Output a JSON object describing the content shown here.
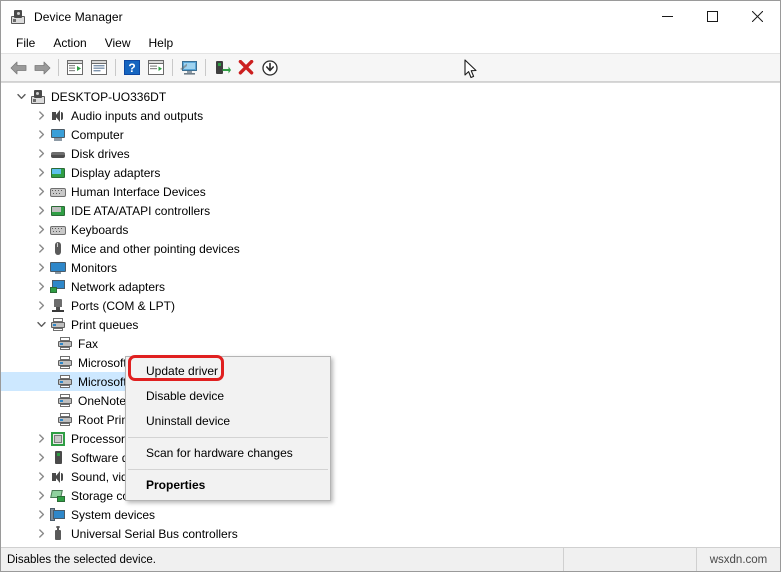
{
  "window": {
    "title": "Device Manager",
    "icon": "device-manager-icon",
    "controls": {
      "minimize": "minimize-icon",
      "maximize": "maximize-icon",
      "close": "close-icon"
    }
  },
  "menubar": {
    "items": [
      {
        "label": "File"
      },
      {
        "label": "Action"
      },
      {
        "label": "View"
      },
      {
        "label": "Help"
      }
    ]
  },
  "toolbar": {
    "buttons": [
      {
        "name": "back-icon",
        "tip": "Back"
      },
      {
        "name": "forward-icon",
        "tip": "Forward"
      },
      {
        "name": "show-hide-console-tree-icon",
        "tip": "Show/Hide Console Tree"
      },
      {
        "name": "properties-icon",
        "tip": "Properties"
      },
      {
        "name": "help-icon",
        "tip": "Help"
      },
      {
        "name": "show-hide-action-pane-icon",
        "tip": "Show/Hide Action Pane"
      },
      {
        "name": "scan-for-hardware-changes-icon",
        "tip": "Scan for hardware changes"
      },
      {
        "name": "update-driver-icon",
        "tip": "Update driver"
      },
      {
        "name": "uninstall-device-icon",
        "tip": "Uninstall device"
      },
      {
        "name": "disable-device-icon",
        "tip": "Disable device"
      }
    ]
  },
  "tree": {
    "root": {
      "label": "DESKTOP-UO336DT",
      "icon": "computer-root-icon",
      "expanded": true
    },
    "nodes": [
      {
        "label": "Audio inputs and outputs",
        "icon": "speaker-icon",
        "expanded": false,
        "level": 1
      },
      {
        "label": "Computer",
        "icon": "computer-icon",
        "expanded": false,
        "level": 1
      },
      {
        "label": "Disk drives",
        "icon": "disk-drive-icon",
        "expanded": false,
        "level": 1
      },
      {
        "label": "Display adapters",
        "icon": "display-adapter-icon",
        "expanded": false,
        "level": 1
      },
      {
        "label": "Human Interface Devices",
        "icon": "hid-icon",
        "expanded": false,
        "level": 1
      },
      {
        "label": "IDE ATA/ATAPI controllers",
        "icon": "ide-controller-icon",
        "expanded": false,
        "level": 1
      },
      {
        "label": "Keyboards",
        "icon": "keyboard-icon",
        "expanded": false,
        "level": 1
      },
      {
        "label": "Mice and other pointing devices",
        "icon": "mouse-icon",
        "expanded": false,
        "level": 1
      },
      {
        "label": "Monitors",
        "icon": "monitor-icon",
        "expanded": false,
        "level": 1
      },
      {
        "label": "Network adapters",
        "icon": "network-adapter-icon",
        "expanded": false,
        "level": 1
      },
      {
        "label": "Ports (COM & LPT)",
        "icon": "port-icon",
        "expanded": false,
        "level": 1
      },
      {
        "label": "Print queues",
        "icon": "printer-icon",
        "expanded": true,
        "level": 1
      },
      {
        "label": "Fax",
        "icon": "printer-icon",
        "expanded": null,
        "level": 2
      },
      {
        "label": "Microsoft Print to PDF",
        "icon": "printer-icon",
        "expanded": null,
        "level": 2
      },
      {
        "label": "Microsoft XPS Document Writer",
        "icon": "printer-icon",
        "expanded": null,
        "level": 2,
        "selected": true
      },
      {
        "label": "OneNote",
        "icon": "printer-icon",
        "expanded": null,
        "level": 2
      },
      {
        "label": "Root Print Queue",
        "icon": "printer-icon",
        "expanded": null,
        "level": 2
      },
      {
        "label": "Processors",
        "icon": "processor-icon",
        "expanded": false,
        "level": 1
      },
      {
        "label": "Software devices",
        "icon": "software-device-icon",
        "expanded": false,
        "level": 1
      },
      {
        "label": "Sound, video and game controllers",
        "icon": "speaker-icon",
        "expanded": false,
        "level": 1
      },
      {
        "label": "Storage controllers",
        "icon": "storage-controller-icon",
        "expanded": false,
        "level": 1
      },
      {
        "label": "System devices",
        "icon": "system-device-icon",
        "expanded": false,
        "level": 1
      },
      {
        "label": "Universal Serial Bus controllers",
        "icon": "usb-icon",
        "expanded": false,
        "level": 1
      }
    ]
  },
  "context_menu": {
    "items": [
      {
        "label": "Update driver",
        "type": "item",
        "highlighted": true
      },
      {
        "label": "Disable device",
        "type": "item"
      },
      {
        "label": "Uninstall device",
        "type": "item"
      },
      {
        "type": "separator"
      },
      {
        "label": "Scan for hardware changes",
        "type": "item"
      },
      {
        "type": "separator"
      },
      {
        "label": "Properties",
        "type": "item",
        "bold": true
      }
    ],
    "highlight_color": "#e02020"
  },
  "statusbar": {
    "message": "Disables the selected device.",
    "middle": "",
    "watermark": "wsxdn.com"
  },
  "colors": {
    "selection": "#cde8ff",
    "toolbar_bg": "#f6f6f6",
    "menu_bg": "#f2f2f2",
    "status_bg": "#f0f0f0",
    "accent_red": "#e02020"
  }
}
